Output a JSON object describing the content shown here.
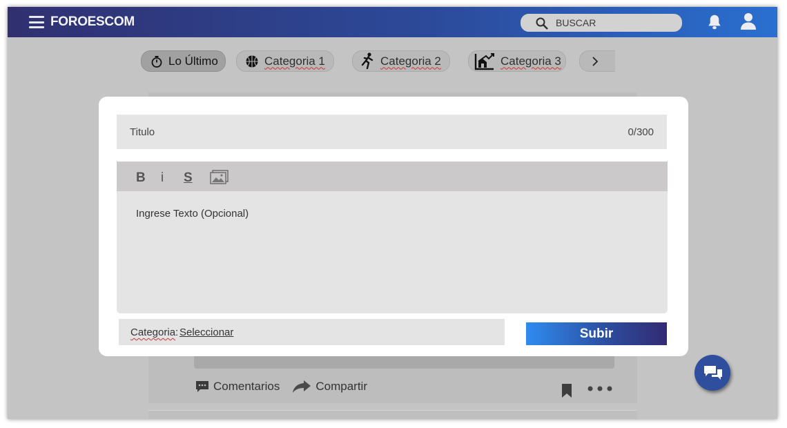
{
  "header": {
    "brand": "FOROESCOM",
    "search_placeholder": "BUSCAR",
    "icons": [
      "menu-icon",
      "search-icon",
      "bell-icon",
      "user-icon"
    ],
    "gradient": [
      "#303070",
      "#2a6fd0"
    ]
  },
  "categories": [
    {
      "label": "Lo Último",
      "icon": "stopwatch-icon",
      "active": true
    },
    {
      "label": "Categoria 1",
      "icon": "basketball-icon"
    },
    {
      "label": "Categoria 2",
      "icon": "runner-icon"
    },
    {
      "label": "Categoria 3",
      "icon": "house-chart-icon"
    }
  ],
  "post": {
    "comments_label": "Comentarios",
    "share_label": "Compartir"
  },
  "modal": {
    "title_placeholder": "Titulo",
    "title_counter": "0/300",
    "toolbar": {
      "bold": "B",
      "italic": "i",
      "strike": "S"
    },
    "body_placeholder": "Ingrese Texto (Opcional)",
    "category_label": "Categoria",
    "category_colon": ":",
    "category_value": "Seleccionar",
    "submit_label": "Subir"
  },
  "colors": {
    "accent": "#2c4fa2",
    "overlay": "#c4c4c4",
    "spellcheck": "#d43030"
  }
}
